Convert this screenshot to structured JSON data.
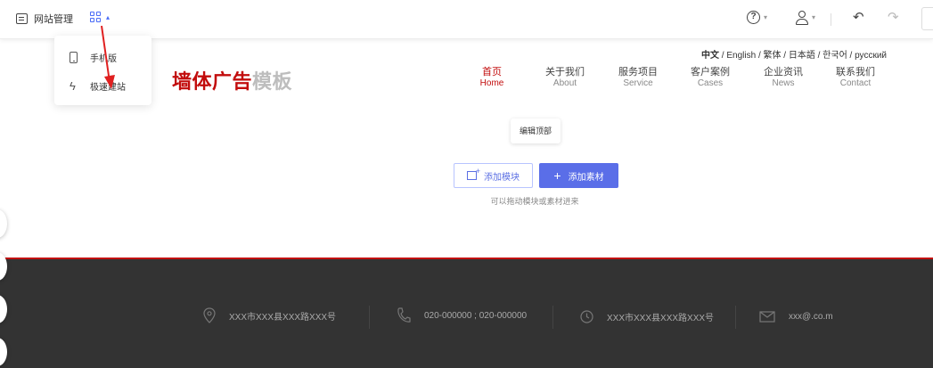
{
  "toolbar": {
    "site_manage_label": "网站管理",
    "apps_caret": "▴",
    "help_caret": "▾",
    "user_caret": "▾",
    "undo_icon": "↶",
    "redo_icon": "↷"
  },
  "dropdown": {
    "items": [
      {
        "label": "手机版",
        "icon": "phone-icon"
      },
      {
        "label": "极速建站",
        "icon": "lightning-icon"
      }
    ]
  },
  "site": {
    "lang_current": "中文",
    "lang_rest": " / English / 繁体 / 日本語 / 한국어 / русский",
    "logo_red": "墙体广告",
    "logo_gray": "模板",
    "nav": [
      {
        "zh": "首页",
        "en": "Home"
      },
      {
        "zh": "关于我们",
        "en": "About"
      },
      {
        "zh": "服务项目",
        "en": "Service"
      },
      {
        "zh": "客户案例",
        "en": "Cases"
      },
      {
        "zh": "企业资讯",
        "en": "News"
      },
      {
        "zh": "联系我们",
        "en": "Contact"
      }
    ]
  },
  "editor": {
    "edit_top_label": "编辑顶部",
    "add_module_label": "添加模块",
    "add_material_label": "添加素材",
    "hint": "可以拖动模块或素材进来"
  },
  "footer": {
    "address": "XXX市XXX县XXX路XXX号",
    "phone": "020-000000 ; 020-000000",
    "address2": "XXX市XXX县XXX路XXX号",
    "email": "xxx@.co.m"
  },
  "colors": {
    "brand_red": "#c20c0c",
    "accent_blue": "#5a6ee8",
    "footer_bg": "#333333"
  }
}
